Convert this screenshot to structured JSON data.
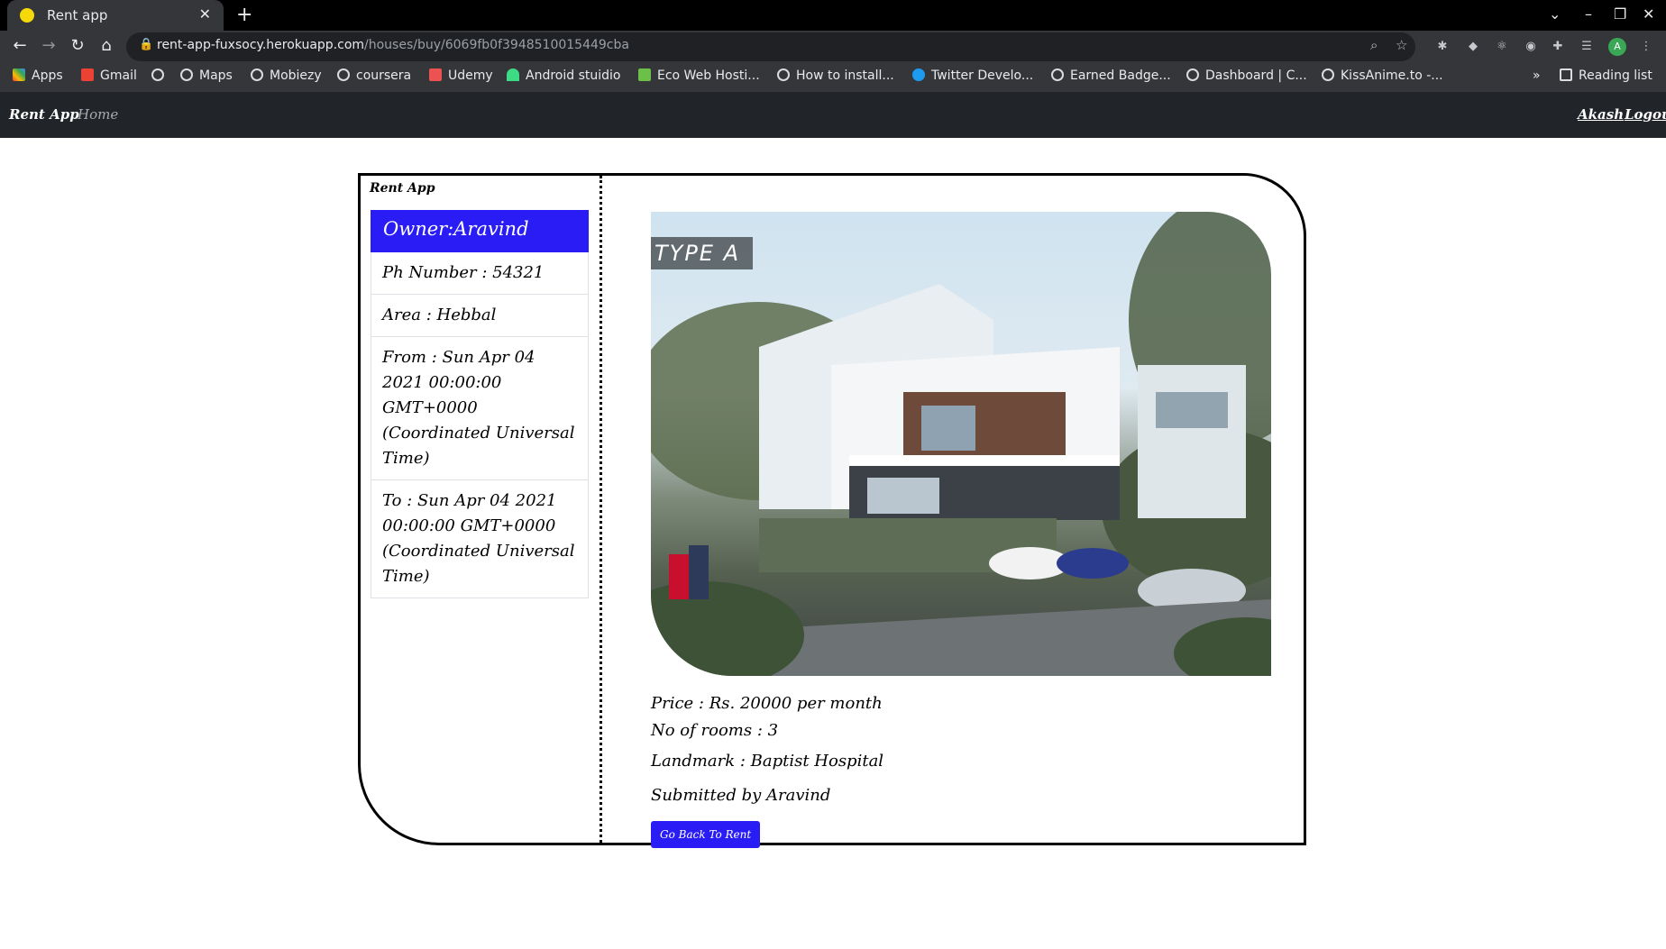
{
  "browser": {
    "tab_title": "Rent app",
    "url_host": "rent-app-fuxsocy.herokuapp.com",
    "url_path": "/houses/buy/6069fb0f3948510015449cba",
    "bookmarks": [
      "Apps",
      "Gmail",
      "",
      "Maps",
      "Mobiezy",
      "coursera",
      "Udemy",
      "Android stuidio",
      "Eco Web Hosti...",
      "How to install...",
      "Twitter Develo...",
      "Earned Badge...",
      "Dashboard | C...",
      "KissAnime.to -..."
    ],
    "reading_list": "Reading list",
    "overflow": "»",
    "avatar_letter": "A"
  },
  "nav": {
    "brand": "Rent App",
    "home": "Home",
    "user": "Akash",
    "logout": "Logout"
  },
  "sidebar": {
    "brand": "Rent App",
    "owner": "Owner:Aravind",
    "items": [
      "Ph Number : 54321",
      "Area : Hebbal",
      "From : Sun Apr 04 2021 00:00:00 GMT+0000 (Coordinated Universal Time)",
      "To : Sun Apr 04 2021 00:00:00 GMT+0000 (Coordinated Universal Time)"
    ]
  },
  "listing": {
    "image_label": "TYPE A",
    "price": "Price : Rs. 20000 per month",
    "rooms": "No of rooms : 3",
    "landmark": "Landmark : Baptist Hospital",
    "submitted": "Submitted by Aravind",
    "back_button": "Go Back To Rent"
  },
  "colors": {
    "accent": "#2a1cf5",
    "navbar": "#212529",
    "chrome": "#35363a"
  }
}
